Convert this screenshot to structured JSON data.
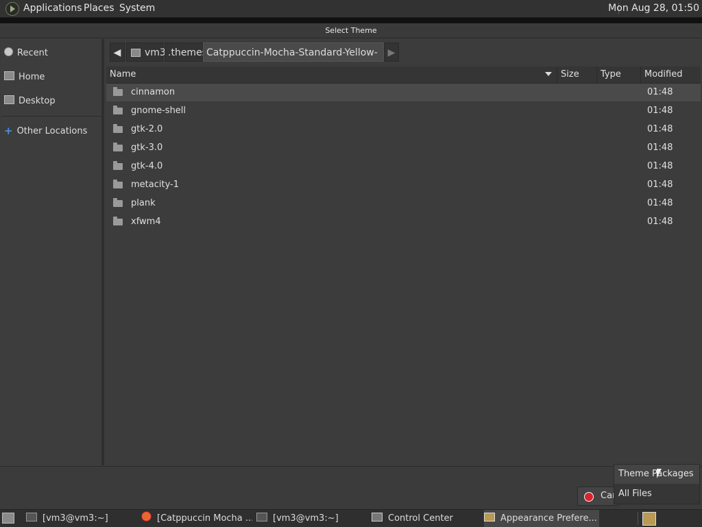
{
  "top_panel": {
    "menus": [
      "Applications",
      "Places",
      "System"
    ],
    "clock": "Mon Aug 28, 01:50",
    "icons": {
      "logo": "distro-logo-icon"
    }
  },
  "dialog": {
    "title": "Select Theme"
  },
  "sidebar": {
    "items": [
      {
        "label": "Recent",
        "icon": "clock-icon"
      },
      {
        "label": "Home",
        "icon": "home-icon"
      },
      {
        "label": "Desktop",
        "icon": "desktop-icon"
      },
      {
        "label": "Other Locations",
        "icon": "plus-icon"
      }
    ]
  },
  "pathbar": {
    "crumbs": [
      "vm3",
      ".themes",
      "Catppuccin-Mocha-Standard-Yellow-Dark"
    ],
    "back_glyph": "◀",
    "forward_glyph": "▶"
  },
  "filelist": {
    "columns": [
      "Name",
      "Size",
      "Type",
      "Modified"
    ],
    "sort_column": "Name",
    "rows": [
      {
        "name": "cinnamon",
        "modified": "01:48",
        "selected": true
      },
      {
        "name": "gnome-shell",
        "modified": "01:48"
      },
      {
        "name": "gtk-2.0",
        "modified": "01:48"
      },
      {
        "name": "gtk-3.0",
        "modified": "01:48"
      },
      {
        "name": "gtk-4.0",
        "modified": "01:48"
      },
      {
        "name": "metacity-1",
        "modified": "01:48"
      },
      {
        "name": "plank",
        "modified": "01:48"
      },
      {
        "name": "xfwm4",
        "modified": "01:48"
      }
    ]
  },
  "buttons": {
    "cancel_label": "Car"
  },
  "filter_popup": {
    "options": [
      "Theme Packages",
      "All Files"
    ]
  },
  "taskbar": {
    "tasks": [
      {
        "label": "[vm3@vm3:~]",
        "icon": "terminal-icon"
      },
      {
        "label": "[Catppuccin Mocha ...",
        "icon": "firefox-icon"
      },
      {
        "label": "[vm3@vm3:~]",
        "icon": "terminal-icon"
      },
      {
        "label": "Control Center",
        "icon": "control-center-icon"
      },
      {
        "label": "Appearance Prefere...",
        "icon": "appearance-icon",
        "active": true
      }
    ]
  }
}
